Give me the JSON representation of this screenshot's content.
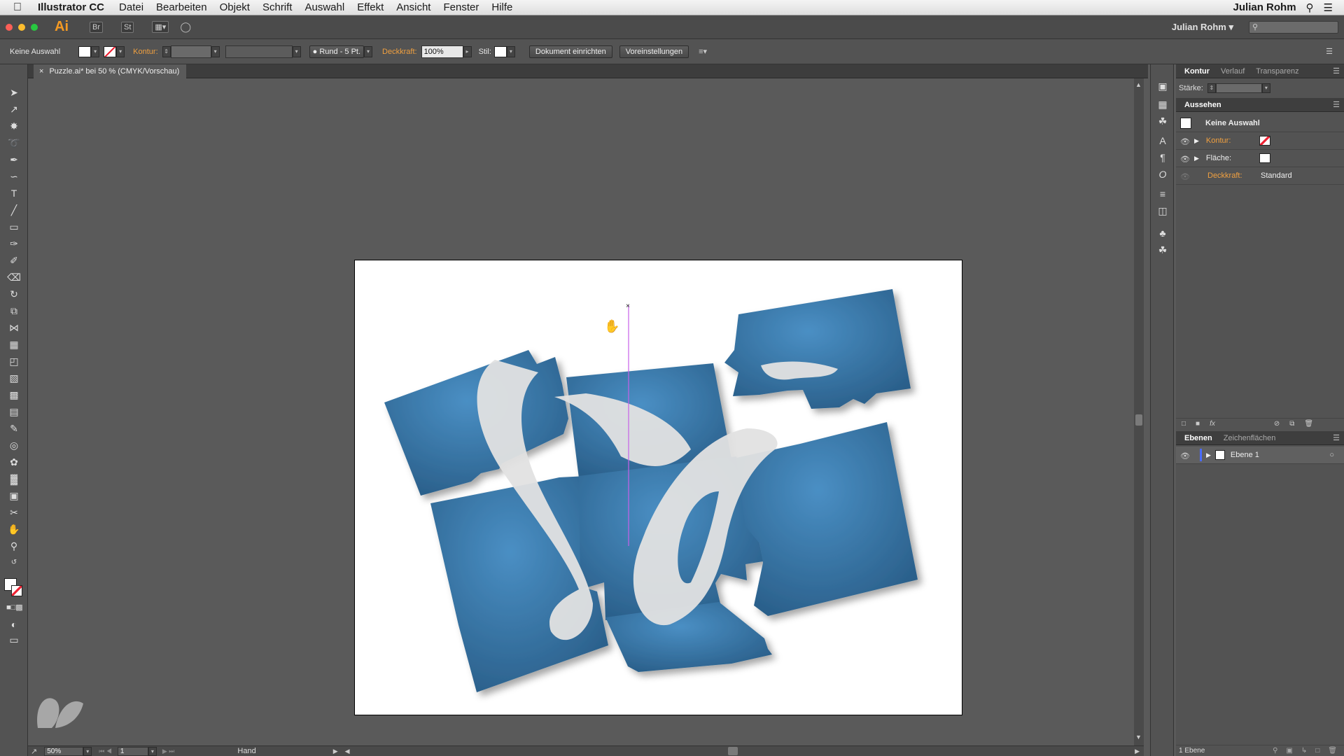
{
  "menubar": {
    "app": "Illustrator CC",
    "items": [
      "Datei",
      "Bearbeiten",
      "Objekt",
      "Schrift",
      "Auswahl",
      "Effekt",
      "Ansicht",
      "Fenster",
      "Hilfe"
    ],
    "user": "Julian Rohm"
  },
  "appbar": {
    "logo": "Ai",
    "bridge": "Br",
    "stock": "St",
    "workspace": "Julian Rohm",
    "search_placeholder": ""
  },
  "control": {
    "selection": "Keine Auswahl",
    "stroke_label": "Kontur:",
    "brush": "Rund - 5 Pt.",
    "opacity_label": "Deckkraft:",
    "opacity_value": "100%",
    "style_label": "Stil:",
    "doc_setup": "Dokument einrichten",
    "prefs": "Voreinstellungen"
  },
  "document": {
    "tab": "Puzzle.ai* bei 50 % (CMYK/Vorschau)",
    "close": "×"
  },
  "status": {
    "zoom": "50%",
    "page": "1",
    "tool": "Hand"
  },
  "stroke_panel": {
    "tabs": [
      "Kontur",
      "Verlauf",
      "Transparenz"
    ],
    "weight_label": "Stärke:"
  },
  "appearance_panel": {
    "title": "Aussehen",
    "header": "Keine Auswahl",
    "rows": [
      {
        "label": "Kontur:",
        "value": ""
      },
      {
        "label": "Fläche:",
        "value": ""
      },
      {
        "label": "Deckkraft:",
        "value": "Standard"
      }
    ]
  },
  "layers_panel": {
    "tabs": [
      "Ebenen",
      "Zeichenflächen"
    ],
    "layer": "Ebene 1",
    "count": "1 Ebene"
  },
  "colors": {
    "puzzle_blue": "#2f6d9c",
    "accent_orange": "#f0a040",
    "guide": "#c860e8"
  }
}
